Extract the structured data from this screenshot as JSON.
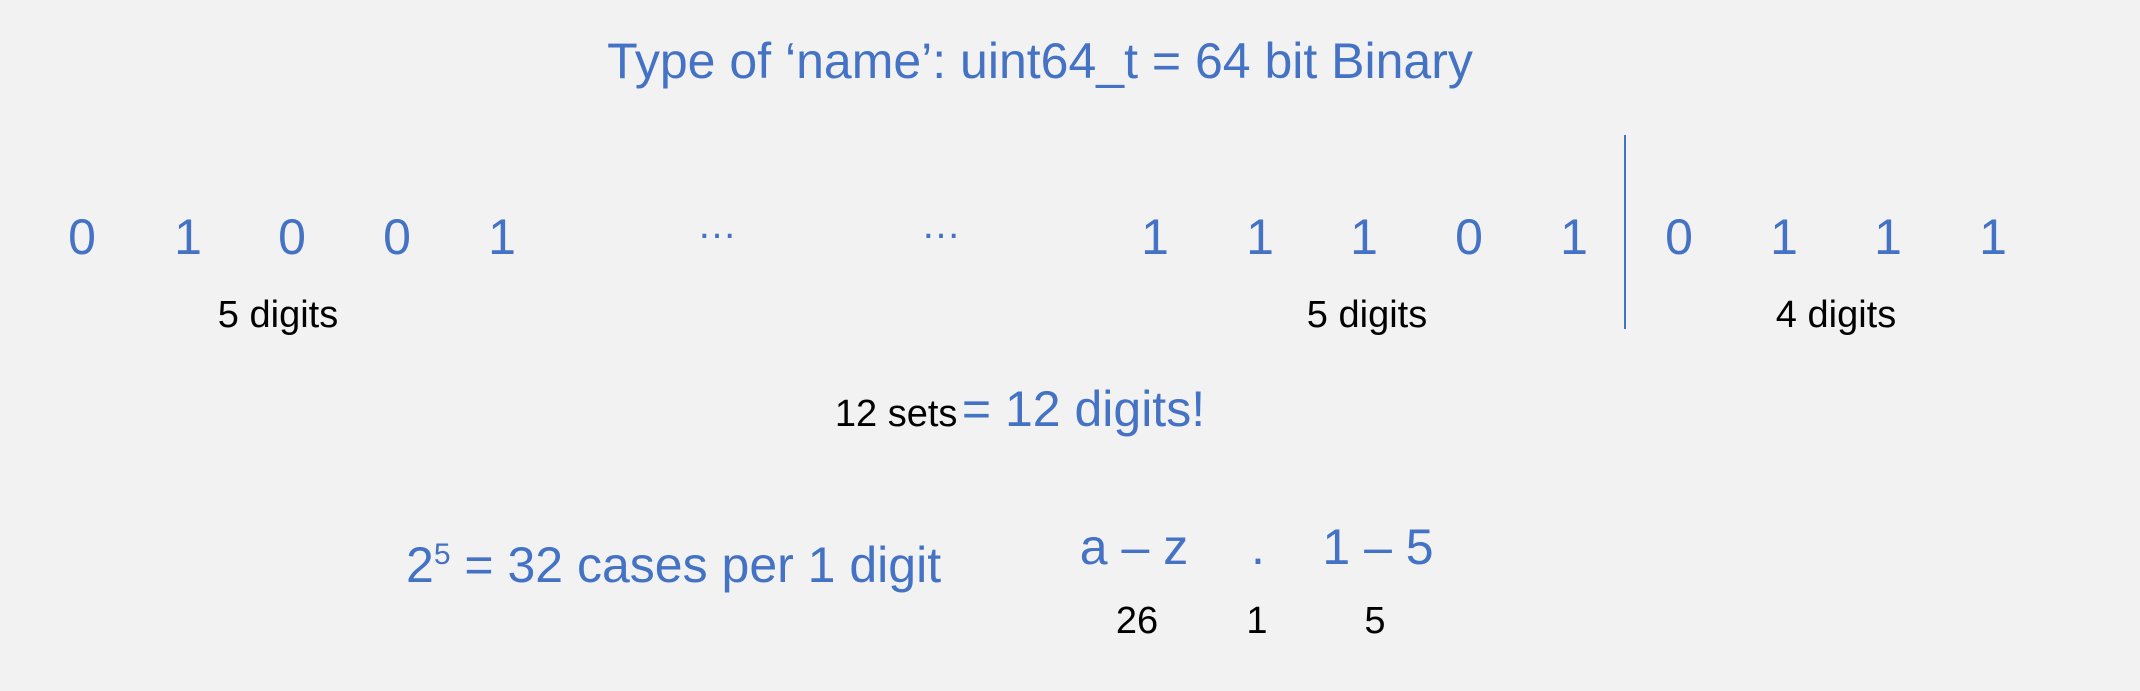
{
  "title": "Type of ‘name’: uint64_t = 64 bit Binary",
  "colors": {
    "accent": "#4472c4",
    "text": "#000000",
    "background": "#f2f2f2"
  },
  "bits": {
    "first_group": [
      "0",
      "1",
      "0",
      "0",
      "1"
    ],
    "ellipsis": [
      "…",
      "…"
    ],
    "last_group": [
      "1",
      "1",
      "1",
      "0",
      "1"
    ],
    "tail_group": [
      "0",
      "1",
      "1",
      "1"
    ]
  },
  "group_labels": {
    "first": "5 digits",
    "last": "5 digits",
    "tail": "4 digits"
  },
  "sets_line": {
    "label": "12 sets",
    "result": "= 12 digits!"
  },
  "cases_line": {
    "base": "2",
    "exponent": "5",
    "rest": "= 32 cases per 1 digit"
  },
  "characters": [
    {
      "range": "a –  z",
      "count": "26"
    },
    {
      "range": ".",
      "count": "1"
    },
    {
      "range": "1 –  5",
      "count": "5"
    }
  ]
}
